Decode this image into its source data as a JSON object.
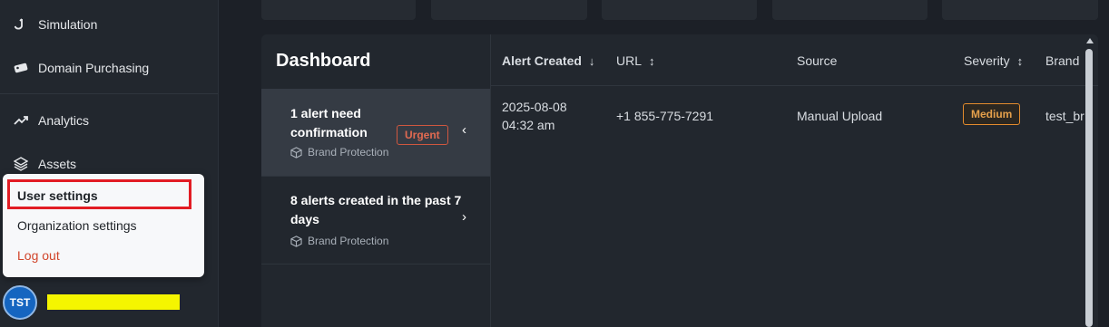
{
  "sidebar": {
    "items": [
      {
        "label": "Simulation",
        "icon": "hook-icon"
      },
      {
        "label": "Domain Purchasing",
        "icon": "tag-icon"
      },
      {
        "label": "Analytics",
        "icon": "trend-icon"
      },
      {
        "label": "Assets",
        "icon": "layers-icon"
      }
    ]
  },
  "user_menu": {
    "items": [
      "User settings",
      "Organization settings",
      "Log out"
    ]
  },
  "user": {
    "initials": "TST"
  },
  "dashboard": {
    "title": "Dashboard",
    "items": [
      {
        "title": "1 alert need confirmation",
        "badge": "Urgent",
        "source": "Brand Protection",
        "chevron": "‹"
      },
      {
        "title": "8 alerts created in the past 7 days",
        "source": "Brand Protection",
        "chevron": "›"
      }
    ]
  },
  "table": {
    "headers": {
      "created": "Alert Created",
      "url": "URL",
      "source": "Source",
      "severity": "Severity",
      "brand": "Brand"
    },
    "sort_icons": {
      "created": "↓",
      "url": "↕",
      "severity": "↕"
    },
    "rows": [
      {
        "created_date": "2025-08-08",
        "created_time": "04:32 am",
        "url": "+1 855-775-7291",
        "source": "Manual Upload",
        "severity": "Medium",
        "brand": "test_br"
      }
    ]
  },
  "colors": {
    "urgent": "#e16a51",
    "medium": "#e5a04b",
    "highlight": "#e21c24",
    "avatar": "#1565c0",
    "redaction": "#f5f500"
  }
}
